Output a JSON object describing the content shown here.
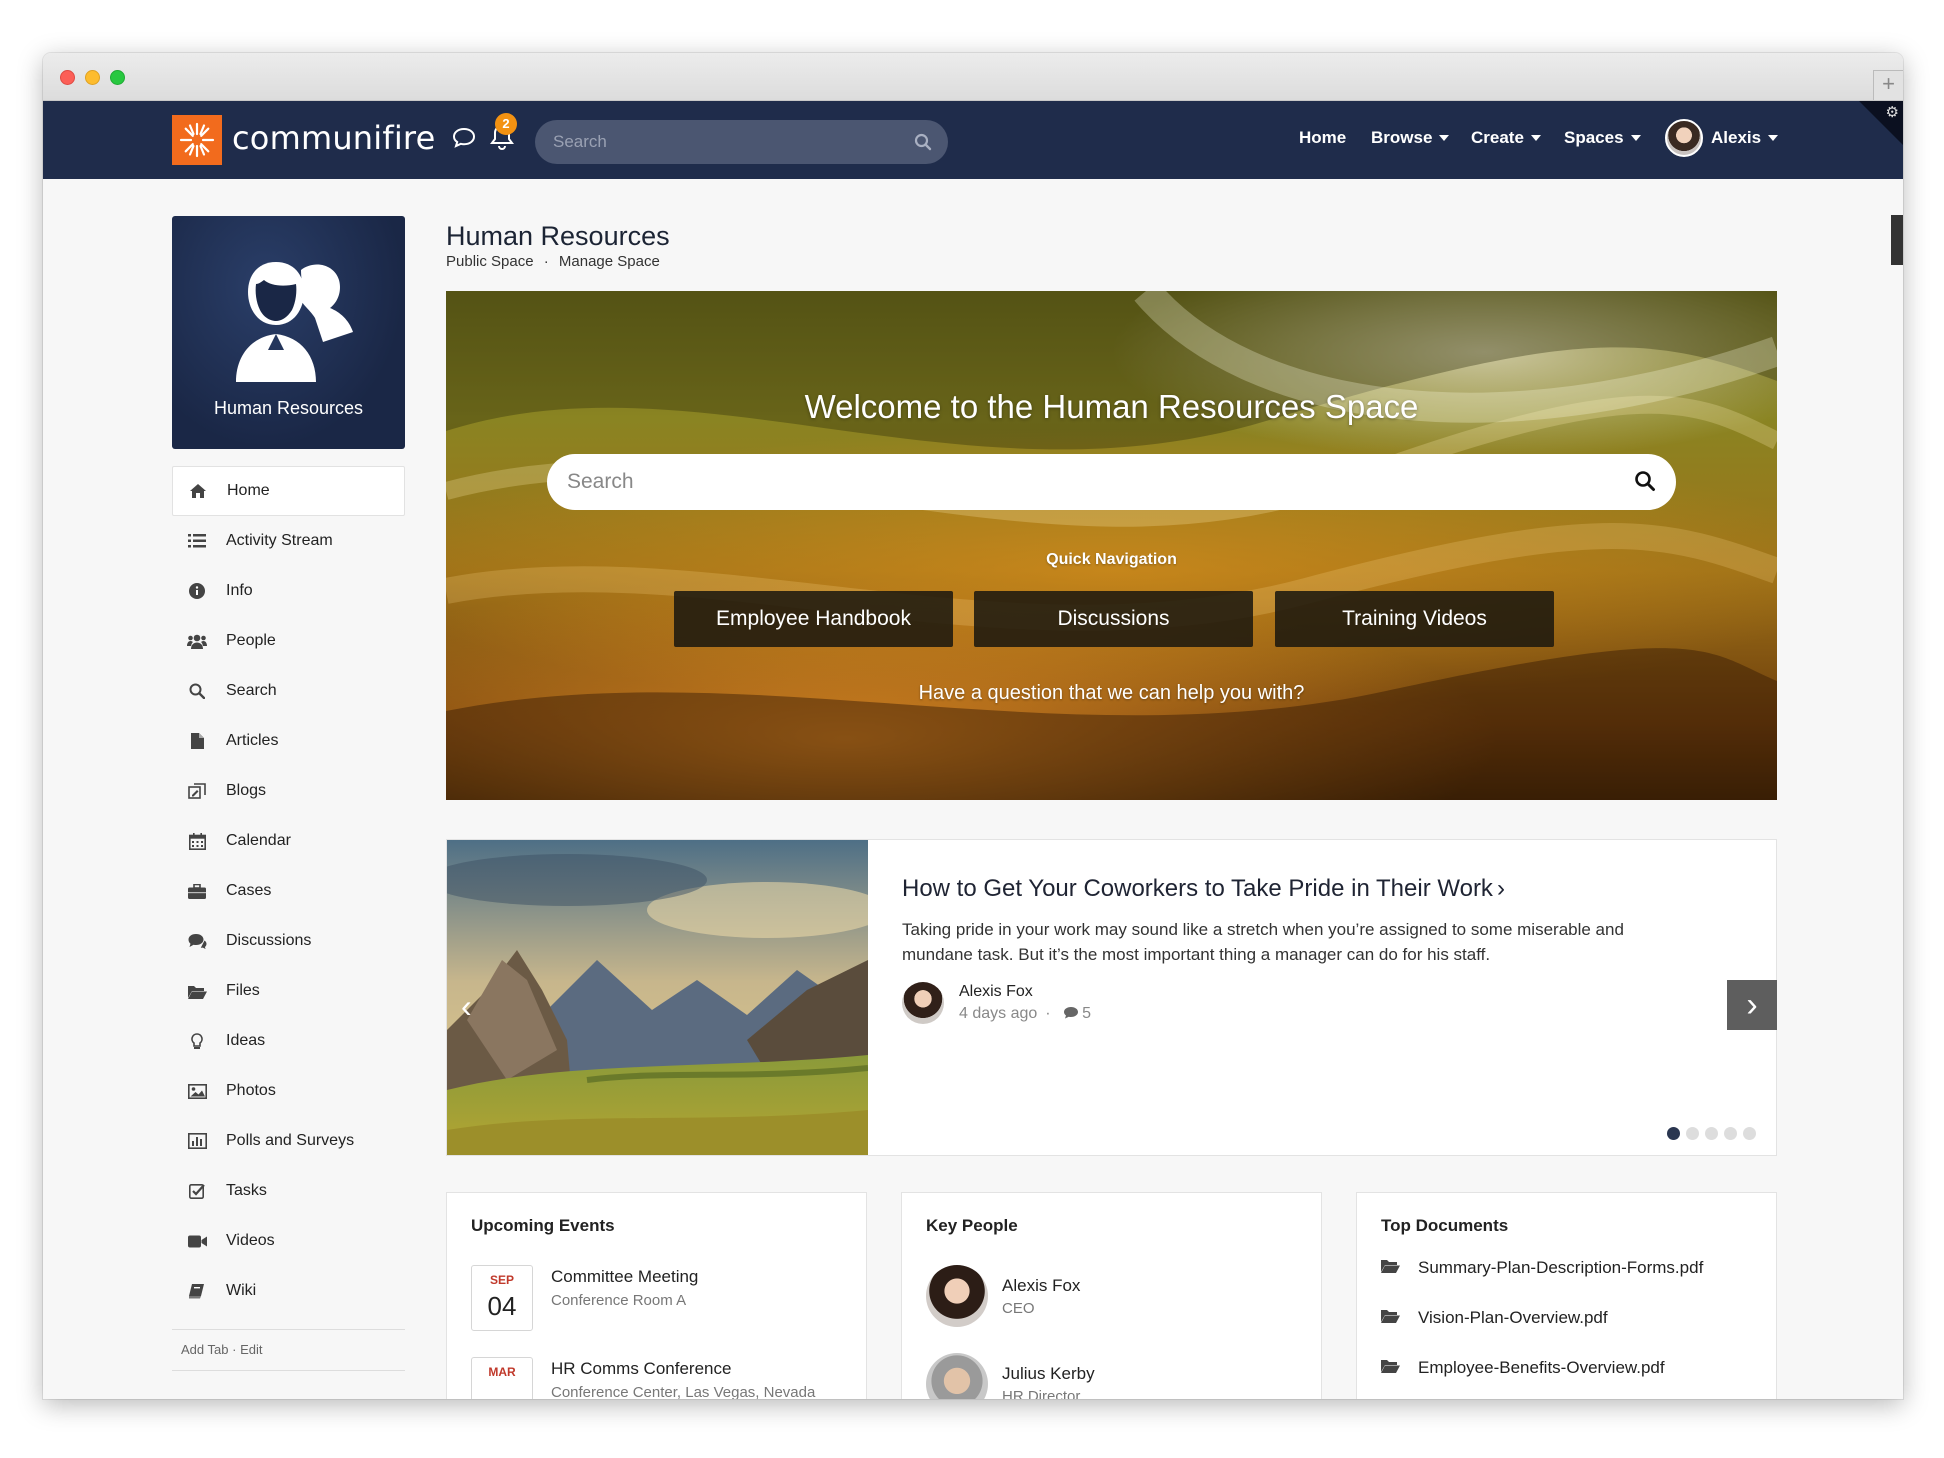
{
  "brand": {
    "name": "communifire",
    "accent": "#f26b1d",
    "nav_bg": "#1f2c4b"
  },
  "header": {
    "notification_count": "2",
    "search_placeholder": "Search",
    "nav": {
      "home": "Home",
      "browse": "Browse",
      "create": "Create",
      "spaces": "Spaces",
      "user": "Alexis"
    }
  },
  "space": {
    "card_name": "Human Resources",
    "title": "Human Resources",
    "subtitle_public": "Public Space",
    "subtitle_sep": "·",
    "subtitle_manage": "Manage Space"
  },
  "sidebar": {
    "items": [
      {
        "label": "Home",
        "icon": "home-icon"
      },
      {
        "label": "Activity Stream",
        "icon": "list-icon"
      },
      {
        "label": "Info",
        "icon": "info-icon"
      },
      {
        "label": "People",
        "icon": "people-icon"
      },
      {
        "label": "Search",
        "icon": "search-icon"
      },
      {
        "label": "Articles",
        "icon": "document-icon"
      },
      {
        "label": "Blogs",
        "icon": "blog-icon"
      },
      {
        "label": "Calendar",
        "icon": "calendar-icon"
      },
      {
        "label": "Cases",
        "icon": "briefcase-icon"
      },
      {
        "label": "Discussions",
        "icon": "chat-icon"
      },
      {
        "label": "Files",
        "icon": "folder-icon"
      },
      {
        "label": "Ideas",
        "icon": "lightbulb-icon"
      },
      {
        "label": "Photos",
        "icon": "image-icon"
      },
      {
        "label": "Polls and Surveys",
        "icon": "bar-chart-icon"
      },
      {
        "label": "Tasks",
        "icon": "checkbox-icon"
      },
      {
        "label": "Videos",
        "icon": "video-icon"
      },
      {
        "label": "Wiki",
        "icon": "book-icon"
      }
    ],
    "footer": {
      "add_tab": "Add Tab",
      "sep": "·",
      "edit": "Edit"
    }
  },
  "hero": {
    "title": "Welcome to the Human Resources Space",
    "search_placeholder": "Search",
    "quick_nav_label": "Quick Navigation",
    "buttons": [
      "Employee Handbook",
      "Discussions",
      "Training Videos"
    ],
    "question": "Have a question that we can help you with?"
  },
  "carousel": {
    "title": "How to Get Your Coworkers to Take Pride in Their Work",
    "excerpt": "Taking pride in your work may sound like a stretch when you’re assigned to some miserable and mundane task. But it’s the most important thing a manager can do for his staff.",
    "author": "Alexis Fox",
    "time": "4 days ago",
    "meta_sep": "·",
    "comments": "5",
    "slide_count": 5,
    "active_slide": 1
  },
  "events": {
    "title": "Upcoming Events",
    "items": [
      {
        "month": "SEP",
        "day": "04",
        "name": "Committee Meeting",
        "location": "Conference Room A"
      },
      {
        "month": "MAR",
        "day": "",
        "name": "HR Comms Conference",
        "location": "Conference Center, Las Vegas, Nevada"
      }
    ]
  },
  "people": {
    "title": "Key People",
    "items": [
      {
        "name": "Alexis Fox",
        "role": "CEO"
      },
      {
        "name": "Julius Kerby",
        "role": "HR Director"
      }
    ]
  },
  "documents": {
    "title": "Top Documents",
    "items": [
      "Summary-Plan-Description-Forms.pdf",
      "Vision-Plan-Overview.pdf",
      "Employee-Benefits-Overview.pdf"
    ]
  }
}
